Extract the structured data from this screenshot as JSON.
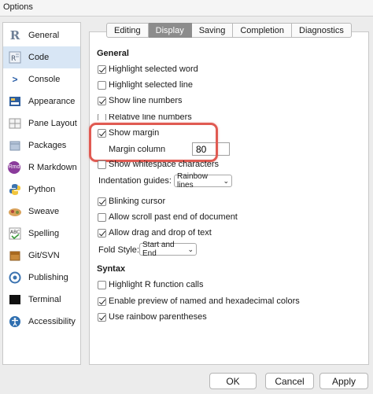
{
  "window": {
    "title": "Options"
  },
  "sidebar": {
    "items": [
      {
        "label": "General",
        "icon": "r-logo-icon",
        "active": false
      },
      {
        "label": "Code",
        "icon": "code-icon",
        "active": true
      },
      {
        "label": "Console",
        "icon": "console-icon",
        "active": false
      },
      {
        "label": "Appearance",
        "icon": "appearance-icon",
        "active": false
      },
      {
        "label": "Pane Layout",
        "icon": "pane-layout-icon",
        "active": false
      },
      {
        "label": "Packages",
        "icon": "packages-icon",
        "active": false
      },
      {
        "label": "R Markdown",
        "icon": "rmarkdown-icon",
        "active": false
      },
      {
        "label": "Python",
        "icon": "python-icon",
        "active": false
      },
      {
        "label": "Sweave",
        "icon": "sweave-icon",
        "active": false
      },
      {
        "label": "Spelling",
        "icon": "spelling-icon",
        "active": false
      },
      {
        "label": "Git/SVN",
        "icon": "git-icon",
        "active": false
      },
      {
        "label": "Publishing",
        "icon": "publishing-icon",
        "active": false
      },
      {
        "label": "Terminal",
        "icon": "terminal-icon",
        "active": false
      },
      {
        "label": "Accessibility",
        "icon": "accessibility-icon",
        "active": false
      }
    ]
  },
  "tabs": [
    {
      "label": "Editing",
      "active": false
    },
    {
      "label": "Display",
      "active": true
    },
    {
      "label": "Saving",
      "active": false
    },
    {
      "label": "Completion",
      "active": false
    },
    {
      "label": "Diagnostics",
      "active": false
    }
  ],
  "general": {
    "title": "General",
    "highlight_selected_word": {
      "label": "Highlight selected word",
      "checked": true
    },
    "highlight_selected_line": {
      "label": "Highlight selected line",
      "checked": false
    },
    "show_line_numbers": {
      "label": "Show line numbers",
      "checked": true
    },
    "relative_line_numbers": {
      "label": "Relative line numbers",
      "checked": false
    },
    "show_margin": {
      "label": "Show margin",
      "checked": true
    },
    "margin_column": {
      "label": "Margin column",
      "value": "80"
    },
    "show_whitespace": {
      "label": "Show whitespace characters",
      "checked": false
    },
    "indentation_guides": {
      "label": "Indentation guides:",
      "value": "Rainbow lines"
    },
    "blinking_cursor": {
      "label": "Blinking cursor",
      "checked": true
    },
    "scroll_past_end": {
      "label": "Allow scroll past end of document",
      "checked": false
    },
    "drag_drop": {
      "label": "Allow drag and drop of text",
      "checked": true
    },
    "fold_style": {
      "label": "Fold Style:",
      "value": "Start and End"
    }
  },
  "syntax": {
    "title": "Syntax",
    "highlight_r_calls": {
      "label": "Highlight R function calls",
      "checked": false
    },
    "preview_colors": {
      "label": "Enable preview of named and hexadecimal colors",
      "checked": true
    },
    "rainbow_parens": {
      "label": "Use rainbow parentheses",
      "checked": true
    }
  },
  "buttons": {
    "ok": "OK",
    "cancel": "Cancel",
    "apply": "Apply"
  },
  "colors": {
    "highlight_box": "#e05a52",
    "active_tab": "#8c8c8c",
    "active_sidebar": "#d8e6f5"
  }
}
